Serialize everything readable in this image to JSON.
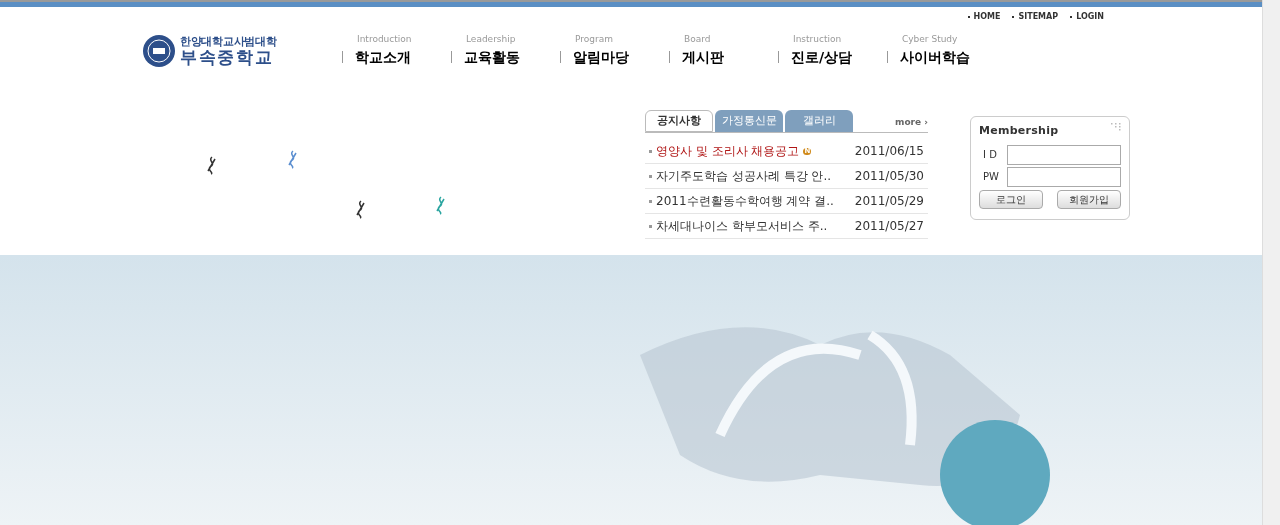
{
  "utility_links": [
    "HOME",
    "SITEMAP",
    "LOGIN"
  ],
  "logo": {
    "line1": "한양대학교사범대학",
    "line2": "부속중학교"
  },
  "nav": [
    {
      "sub": "Introduction",
      "label": "학교소개"
    },
    {
      "sub": "Leadership",
      "label": "교육활동"
    },
    {
      "sub": "Program",
      "label": "알림마당"
    },
    {
      "sub": "Board",
      "label": "게시판"
    },
    {
      "sub": "Instruction",
      "label": "진로/상담"
    },
    {
      "sub": "Cyber Study",
      "label": "사이버학습"
    }
  ],
  "board": {
    "tabs": [
      {
        "label": "공지사항",
        "selected": true
      },
      {
        "label": "가정통신문",
        "selected": false
      },
      {
        "label": "갤러리",
        "selected": false
      }
    ],
    "more": "more ›",
    "posts": [
      {
        "title": "영양사 및 조리사 채용공고",
        "date": "2011/06/15",
        "highlighted": true,
        "badge": "N"
      },
      {
        "title": "자기주도학습 성공사례 특강 안..",
        "date": "2011/05/30",
        "highlighted": false
      },
      {
        "title": "2011수련활동수학여행 계약 결..",
        "date": "2011/05/29",
        "highlighted": false
      },
      {
        "title": "차세대나이스 학부모서비스 주..",
        "date": "2011/05/27",
        "highlighted": false
      }
    ]
  },
  "membership": {
    "title": "Membership",
    "fields": [
      {
        "label": "I D"
      },
      {
        "label": "PW"
      }
    ],
    "buttons": [
      "로그인",
      "회원가입"
    ]
  }
}
